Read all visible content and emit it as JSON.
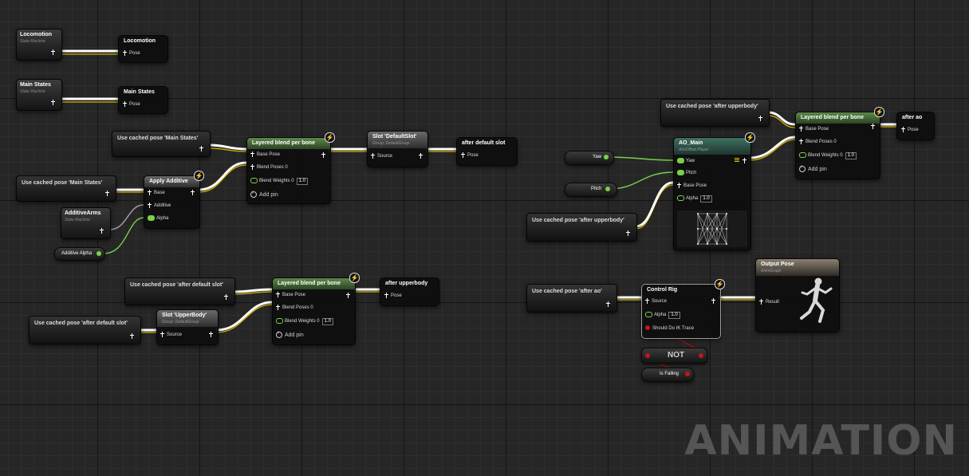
{
  "graph": {
    "watermark": "ANIMATION",
    "state_machines": [
      {
        "title": "Locomotion",
        "subtitle": "State Machine"
      },
      {
        "title": "Main States",
        "subtitle": "State Machine"
      },
      {
        "title": "AdditiveArms",
        "subtitle": "State Machine"
      }
    ],
    "save_cached_pose": [
      {
        "title": "Locomotion",
        "pin": "Pose"
      },
      {
        "title": "Main States",
        "pin": "Pose"
      },
      {
        "title": "after default slot",
        "pin": "Pose"
      },
      {
        "title": "after upperbody",
        "pin": "Pose"
      },
      {
        "title": "after ao",
        "pin": "Pose"
      }
    ],
    "use_cached_pose": [
      "Use cached pose 'Main States'",
      "Use cached pose 'Main States'",
      "Use cached pose 'after default slot'",
      "Use cached pose 'after default slot'",
      "Use cached pose 'after upperbody'",
      "Use cached pose 'after upperbody'",
      "Use cached pose 'after ao'"
    ],
    "variables": {
      "additive_alpha": "Additive Alpha",
      "yaw": "Yaw",
      "pitch": "Pitch",
      "is_falling": "Is Falling"
    },
    "apply_additive": {
      "title": "Apply Additive",
      "pins": [
        "Base",
        "Additive",
        "Alpha"
      ]
    },
    "layered_blend": {
      "title": "Layered blend per bone",
      "base_pose": "Base Pose",
      "blend_poses": "Blend Poses 0",
      "blend_weights": "Blend Weights 0",
      "weight_value": "1.0",
      "add_pin": "Add pin"
    },
    "slot_default": {
      "title": "Slot 'DefaultSlot'",
      "subtitle": "Group: DefaultGroup",
      "pin": "Source"
    },
    "slot_upperbody": {
      "title": "Slot 'UpperBody'",
      "subtitle": "Group: DefaultGroup",
      "pin": "Source"
    },
    "ao_main": {
      "title": "AO_Main",
      "subtitle": "AimOffset Player",
      "pins": [
        "Yaw",
        "Pitch",
        "Base Pose",
        "Alpha"
      ],
      "alpha_value": "1.0"
    },
    "control_rig": {
      "title": "Control Rig",
      "pins": [
        "Source",
        "Alpha",
        "Should Do IK Trace"
      ],
      "alpha_value": "1.0"
    },
    "not_node": "NOT",
    "output_pose": {
      "title": "Output Pose",
      "subtitle": "AnimGraph",
      "pin": "Result"
    },
    "colors": {
      "pose_wire": "#ffffff",
      "exec_wire_yellow": "#d6b400",
      "float_wire": "#7ad04a",
      "bool_wire": "#a01010",
      "blend_header": "#5c8a4a",
      "grid_major": "#141414"
    }
  }
}
